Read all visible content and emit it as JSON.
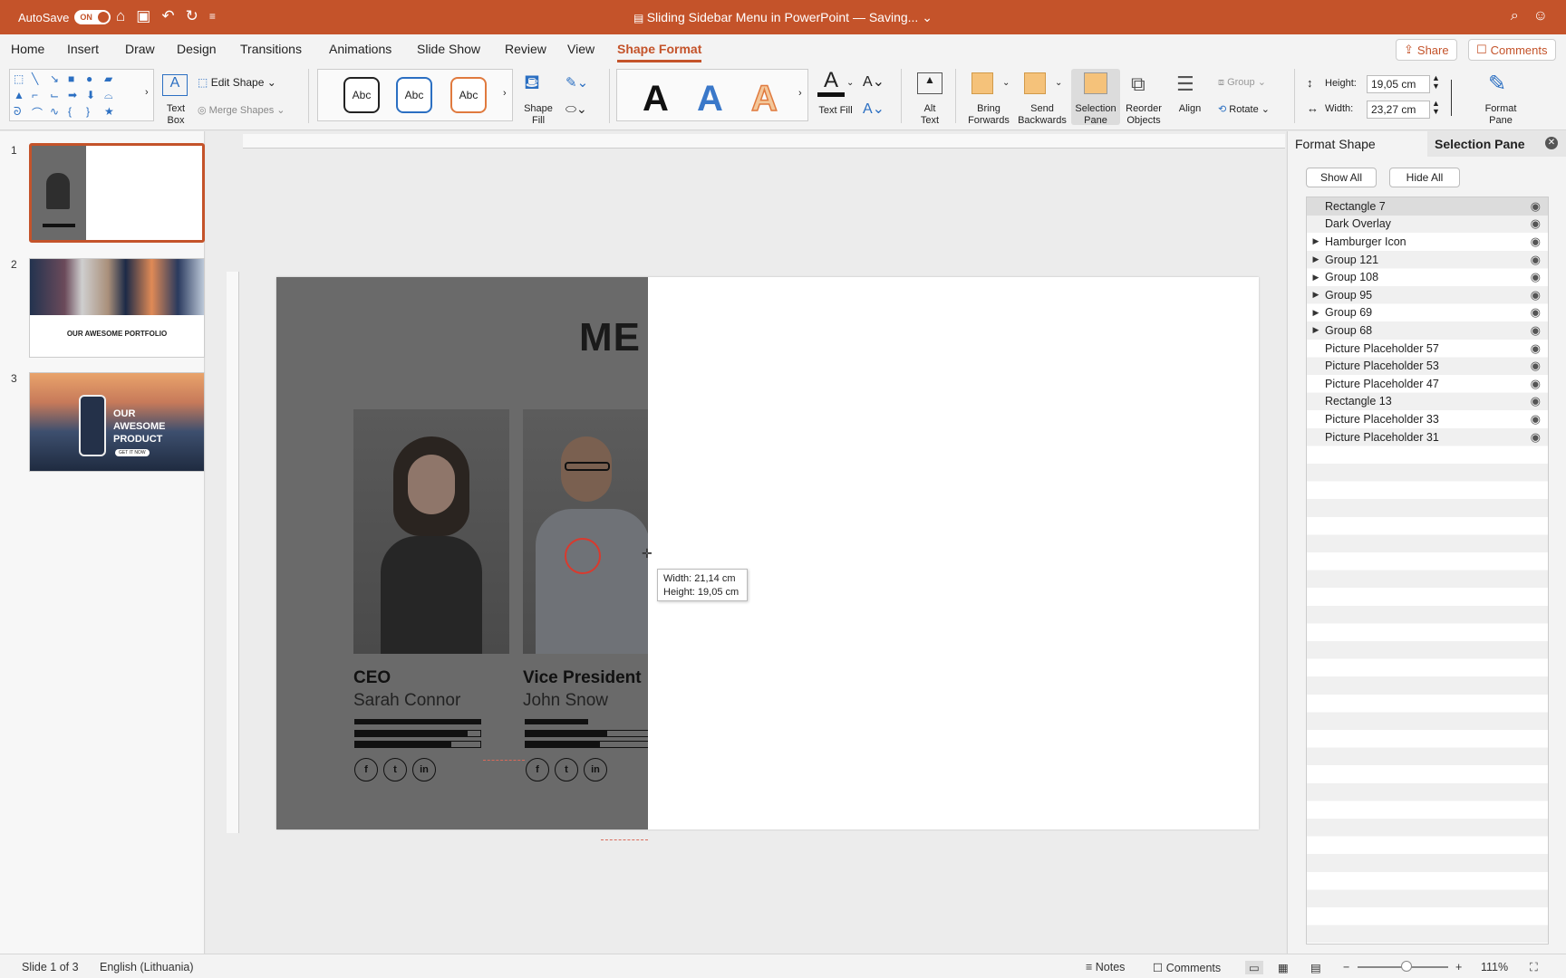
{
  "titlebar": {
    "autosave_label": "AutoSave",
    "toggle_label": "ON",
    "doc_title": "Sliding Sidebar Menu in PowerPoint — Saving... ⌄"
  },
  "menu": {
    "tabs": [
      "Home",
      "Insert",
      "Draw",
      "Design",
      "Transitions",
      "Animations",
      "Slide Show",
      "Review",
      "View",
      "Shape Format"
    ],
    "active_tab": "Shape Format",
    "share_label": "Share",
    "comments_label": "Comments"
  },
  "ribbon": {
    "text_box": "Text\nBox",
    "edit_shape": "Edit Shape",
    "merge_shapes": "Merge Shapes",
    "style_abc": [
      "Abc",
      "Abc",
      "Abc"
    ],
    "shape_fill": "Shape\nFill",
    "text_fill": "Text Fill",
    "alt_text": "Alt\nText",
    "bring_forwards": "Bring\nForwards",
    "send_backwards": "Send\nBackwards",
    "selection_pane": "Selection\nPane",
    "reorder_objects": "Reorder\nObjects",
    "align": "Align",
    "group": "Group",
    "rotate": "Rotate",
    "height_label": "Height:",
    "height_value": "19,05 cm",
    "width_label": "Width:",
    "width_value": "23,27 cm",
    "format_pane": "Format\nPane",
    "accent_color": "#c4532a"
  },
  "thumbnails": {
    "numbers": [
      "1",
      "2",
      "3"
    ],
    "slide2_caption": "OUR AWESOME PORTFOLIO",
    "slide3_caption": "OUR AWESOME PRODUCT",
    "slide3_button": "GET IT NOW"
  },
  "slide": {
    "heading_partial": "ME",
    "people": [
      {
        "role": "CEO",
        "name": "Sarah Connor"
      },
      {
        "role": "Vice President",
        "name": "John Snow"
      }
    ],
    "social": [
      "f",
      "t",
      "in"
    ]
  },
  "tooltip": {
    "width": "Width: 21,14 cm",
    "height": "Height: 19,05 cm"
  },
  "right_pane": {
    "tab_format": "Format Shape",
    "tab_selection": "Selection Pane",
    "show_all": "Show All",
    "hide_all": "Hide All",
    "items": [
      {
        "label": "Rectangle 7",
        "group": false
      },
      {
        "label": "Dark Overlay",
        "group": false
      },
      {
        "label": "Hamburger Icon",
        "group": true
      },
      {
        "label": "Group 121",
        "group": true
      },
      {
        "label": "Group 108",
        "group": true
      },
      {
        "label": "Group 95",
        "group": true
      },
      {
        "label": "Group 69",
        "group": true
      },
      {
        "label": "Group 68",
        "group": true
      },
      {
        "label": "Picture Placeholder 57",
        "group": false
      },
      {
        "label": "Picture Placeholder 53",
        "group": false
      },
      {
        "label": "Picture Placeholder 47",
        "group": false
      },
      {
        "label": "Rectangle 13",
        "group": false
      },
      {
        "label": "Picture Placeholder 33",
        "group": false
      },
      {
        "label": "Picture Placeholder 31",
        "group": false
      }
    ]
  },
  "statusbar": {
    "slide_info": "Slide 1 of 3",
    "language": "English (Lithuania)",
    "notes": "Notes",
    "comments": "Comments",
    "zoom": "111%"
  }
}
